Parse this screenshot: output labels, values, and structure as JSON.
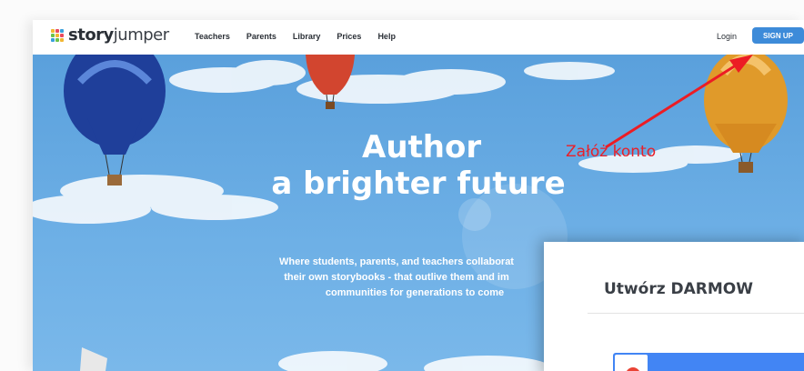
{
  "nav": {
    "logo_bold": "story",
    "logo_light": "jumper",
    "links": [
      "Teachers",
      "Parents",
      "Library",
      "Prices",
      "Help"
    ],
    "login": "Login",
    "signup": "SIGN UP"
  },
  "hero": {
    "headline_line1": "Author",
    "headline_line2": "a brighter future",
    "sub_line1": "Where students, parents, and teachers collaborat",
    "sub_line2": "their own storybooks - that outlive them and im",
    "sub_line3": "communities for generations to come"
  },
  "annotation": {
    "text": "Załóż konto",
    "color": "#e8202a"
  },
  "modal": {
    "title": "Utwórz DARMOW"
  },
  "colors": {
    "signup_bg": "#3d8bd9",
    "sky": "#5aa0dc",
    "google_blue": "#4285f4"
  },
  "icons": [
    "storyjumper-logo-icon",
    "red-arrow-icon",
    "google-icon",
    "hot-air-balloon-icon"
  ]
}
